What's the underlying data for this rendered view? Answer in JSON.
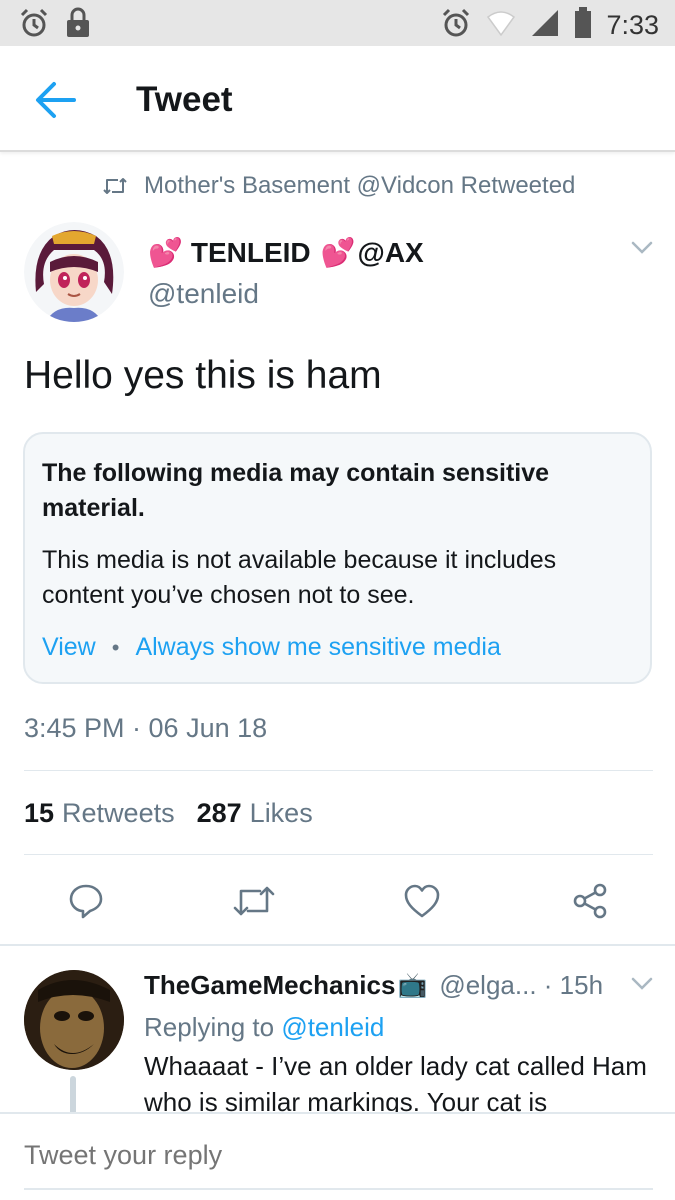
{
  "status_bar": {
    "time": "7:33",
    "left_icons": [
      "alarm-icon",
      "lock-icon"
    ],
    "right_icons": [
      "alarm-icon",
      "wifi-icon",
      "signal-icon",
      "battery-icon"
    ]
  },
  "header": {
    "title": "Tweet",
    "back_icon": "back-arrow-icon"
  },
  "tweet": {
    "retweet_context": "Mother's Basement @Vidcon Retweeted",
    "display_name_prefix_emoji": "💕",
    "display_name_text": "TENLEID",
    "display_name_suffix_emoji": "💕",
    "display_name_tail": "@AX",
    "handle": "@tenleid",
    "text": "Hello yes this is ham",
    "sensitive_media": {
      "title": "The following media may contain sensitive material.",
      "body": "This media is not available because it includes content you’ve chosen not to see.",
      "view_label": "View",
      "separator": "•",
      "always_show_label": "Always show me sensitive media"
    },
    "timestamp": "3:45 PM · 06 Jun 18",
    "retweets_count": "15",
    "retweets_label": "Retweets",
    "likes_count": "287",
    "likes_label": "Likes",
    "action_icons": [
      "reply-icon",
      "retweet-icon",
      "like-icon",
      "share-icon"
    ]
  },
  "reply": {
    "name": "TheGameMechanics",
    "name_emoji": "📺",
    "handle_time": "@elga... · 15h",
    "replying_to_label": "Replying to",
    "replying_to_handle": "@tenleid",
    "text": "Whaaaat - I’ve an older lady cat called Ham who is similar markings. Your cat is"
  },
  "compose": {
    "placeholder": "Tweet your reply"
  },
  "colors": {
    "accent": "#1da1f2",
    "secondary_text": "#657786",
    "primary_text": "#14171a",
    "card_bg": "#f5f8fa"
  }
}
